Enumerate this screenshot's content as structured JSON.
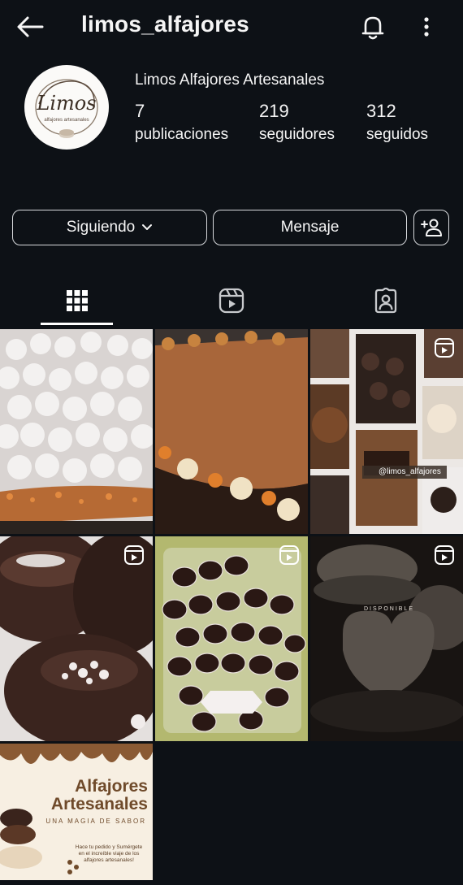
{
  "header": {
    "username": "limos_alfajores",
    "back_icon": "arrow-left-icon",
    "notifications_icon": "bell-icon",
    "menu_icon": "more-vertical-icon"
  },
  "profile": {
    "display_name": "Limos Alfajores Artesanales",
    "avatar_logo_text": "Limos",
    "avatar_logo_subtext": "alfajores artesanales",
    "stats": [
      {
        "value": "7",
        "label": "publicaciones"
      },
      {
        "value": "219",
        "label": "seguidores"
      },
      {
        "value": "312",
        "label": "seguidos"
      }
    ]
  },
  "actions": {
    "follow_label": "Siguiendo",
    "message_label": "Mensaje",
    "add_user_icon": "person-add-icon"
  },
  "tabs": [
    {
      "name": "posts",
      "icon": "grid-icon",
      "active": true
    },
    {
      "name": "reels",
      "icon": "reels-icon",
      "active": false
    },
    {
      "name": "tagged",
      "icon": "tagged-person-icon",
      "active": false
    }
  ],
  "posts": [
    {
      "id": "post-1",
      "type": "photo",
      "subject": "meringue-cake"
    },
    {
      "id": "post-2",
      "type": "photo",
      "subject": "chocolate-cake"
    },
    {
      "id": "post-3",
      "type": "reel",
      "subject": "collage",
      "overlay_text": "@limos_alfajores"
    },
    {
      "id": "post-4",
      "type": "reel",
      "subject": "chocolate-alfajores"
    },
    {
      "id": "post-5",
      "type": "reel",
      "subject": "bonbons-box"
    },
    {
      "id": "post-6",
      "type": "reel",
      "subject": "heart-alfajores",
      "overlay_text": "DISPONIBLE"
    },
    {
      "id": "post-7",
      "type": "photo",
      "subject": "promo-flyer",
      "title_line1": "Alfajores",
      "title_line2": "Artesanales",
      "subtitle": "UNA MAGIA DE SABOR",
      "body_line1": "Hace tu pedido y Sumérgete",
      "body_line2": "en el increíble viaje de los",
      "body_line3": "alfajores artesanales!"
    }
  ],
  "colors": {
    "background": "#0d1116",
    "text": "#f5f5f5",
    "button_border": "#d7d9dc"
  }
}
